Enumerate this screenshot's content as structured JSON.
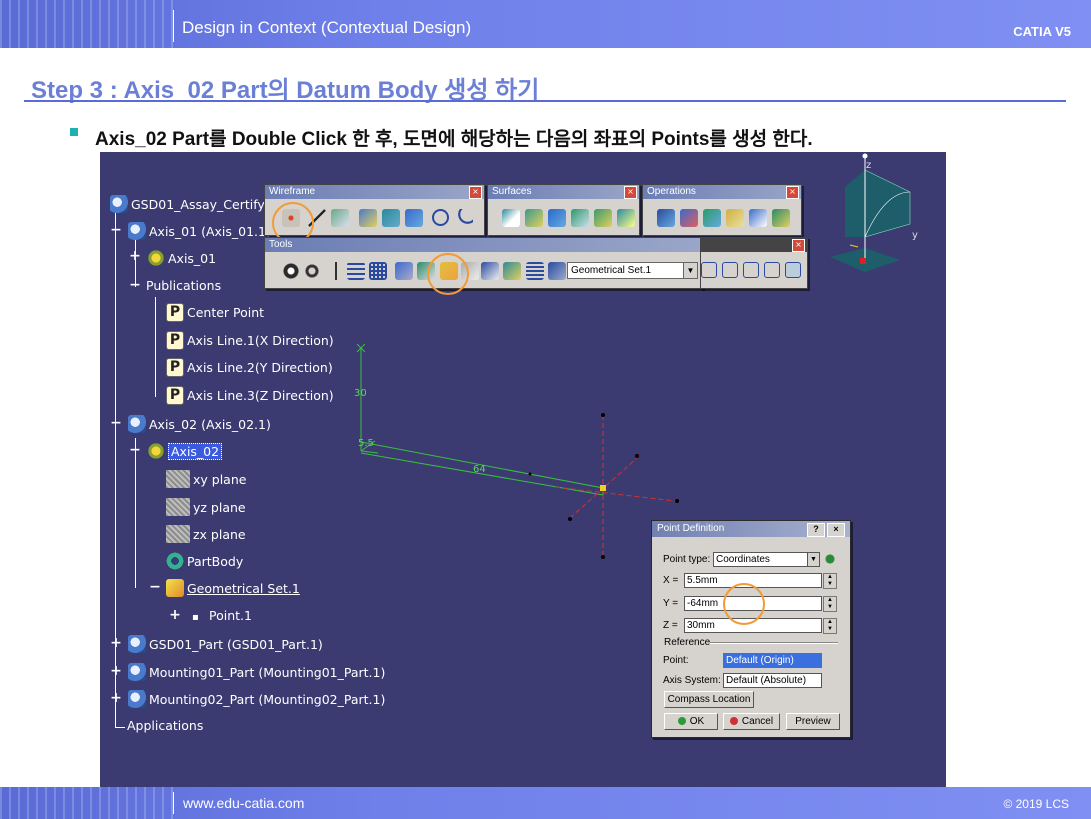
{
  "header": {
    "title": "Design in Context (Contextual Design)",
    "brand": "CATIA V5"
  },
  "step_title": "Step 3 : Axis_02 Part의 Datum Body 생성 하기",
  "instruction": "Axis_02 Part를 Double Click 한 후, 도면에 해당하는 다음의 좌표의 Points를 생성 한다.",
  "tree": {
    "items": [
      {
        "label": "GSD01_Assay_Certify",
        "icon": "product-icon"
      },
      {
        "label": "Axis_01 (Axis_01.1)",
        "icon": "product-icon"
      },
      {
        "label": "Axis_01",
        "icon": "part-gear-icon"
      },
      {
        "label": "Publications",
        "icon": "none"
      },
      {
        "label": "Center Point",
        "icon": "publication-icon"
      },
      {
        "label": "Axis Line.1(X Direction)",
        "icon": "publication-icon"
      },
      {
        "label": "Axis Line.2(Y Direction)",
        "icon": "publication-icon"
      },
      {
        "label": "Axis Line.3(Z Direction)",
        "icon": "publication-icon"
      },
      {
        "label": "Axis_02 (Axis_02.1)",
        "icon": "product-icon"
      },
      {
        "label": "Axis_02",
        "icon": "part-gear-icon"
      },
      {
        "label": "xy plane",
        "icon": "plane-icon"
      },
      {
        "label": "yz plane",
        "icon": "plane-icon"
      },
      {
        "label": "zx plane",
        "icon": "plane-icon"
      },
      {
        "label": "PartBody",
        "icon": "partbody-icon"
      },
      {
        "label": "Geometrical Set.1",
        "icon": "geometrical-set-icon"
      },
      {
        "label": "Point.1",
        "icon": "point-icon"
      },
      {
        "label": "GSD01_Part (GSD01_Part.1)",
        "icon": "product-icon"
      },
      {
        "label": "Mounting01_Part (Mounting01_Part.1)",
        "icon": "product-icon"
      },
      {
        "label": "Mounting02_Part (Mounting02_Part.1)",
        "icon": "product-icon"
      },
      {
        "label": "Applications",
        "icon": "none"
      }
    ]
  },
  "toolbars": {
    "wireframe": "Wireframe",
    "surfaces": "Surfaces",
    "operations": "Operations",
    "tools": "Tools",
    "geoset_value": "Geometrical Set.1"
  },
  "viewer": {
    "dim_vertical": "30",
    "dim_origin": "5.5",
    "dim_length": "64",
    "compass_z": "z",
    "compass_y": "y"
  },
  "dialog": {
    "title": "Point Definition",
    "help": "?",
    "close": "×",
    "point_type_label": "Point type:",
    "point_type_value": "Coordinates",
    "x_label": "X =",
    "x_value": "5.5mm",
    "y_label": "Y =",
    "y_value": "-64mm",
    "z_label": "Z =",
    "z_value": "30mm",
    "reference_label": "Reference",
    "point_label": "Point:",
    "point_value": "Default (Origin)",
    "axis_label": "Axis System:",
    "axis_value": "Default (Absolute)",
    "compass_btn": "Compass Location",
    "ok_btn": "OK",
    "cancel_btn": "Cancel",
    "preview_btn": "Preview"
  },
  "footer": {
    "url": "www.edu-catia.com",
    "copyright": "© 2019 LCS"
  }
}
